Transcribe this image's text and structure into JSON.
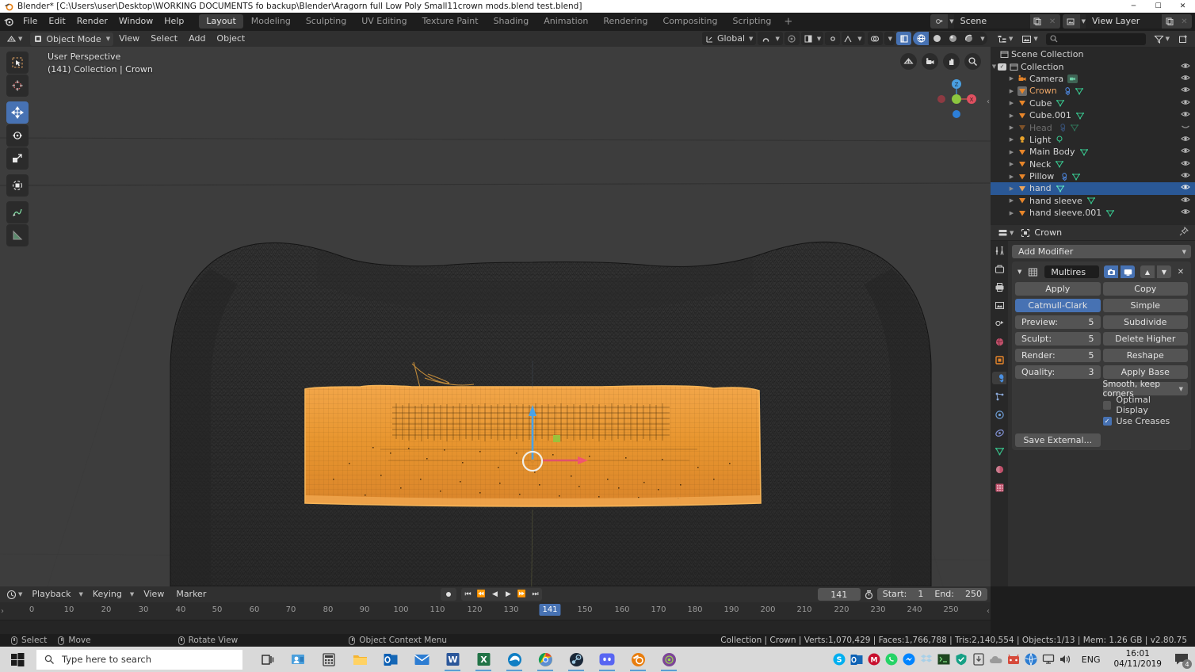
{
  "window": {
    "title": "Blender* [C:\\Users\\user\\Desktop\\WORKING DOCUMENTS fo backup\\Blender\\Aragorn full Low Poly Small11crown mods.blend test.blend]",
    "minimize": "─",
    "maximize": "☐",
    "close": "✕"
  },
  "topbar": {
    "menus": [
      "File",
      "Edit",
      "Render",
      "Window",
      "Help"
    ],
    "tabs": [
      "Layout",
      "Modeling",
      "Sculpting",
      "UV Editing",
      "Texture Paint",
      "Shading",
      "Animation",
      "Rendering",
      "Compositing",
      "Scripting"
    ],
    "tab_active": "Layout",
    "add_tab": "+",
    "scene_name": "Scene",
    "viewlayer_name": "View Layer"
  },
  "viewport_header": {
    "mode": "Object Mode",
    "menus": [
      "View",
      "Select",
      "Add",
      "Object"
    ],
    "transform_orientation": "Global",
    "snap_icon": "magnet-icon",
    "proportional_icon": "proportional-edit-icon"
  },
  "viewport": {
    "perspective_label": "User Perspective",
    "object_label": "(141) Collection | Crown",
    "axis_x": "X",
    "axis_z": "Z",
    "tools": [
      {
        "name": "tweak-tool",
        "glyph": "⬚"
      },
      {
        "name": "cursor-tool",
        "glyph": "⊕"
      },
      {
        "name": "move-tool",
        "glyph": "✛"
      },
      {
        "name": "rotate-tool",
        "glyph": "↺"
      },
      {
        "name": "scale-tool",
        "glyph": "◱"
      },
      {
        "name": "transform-tool",
        "glyph": "▣"
      },
      {
        "name": "annotate-tool",
        "glyph": "✎"
      },
      {
        "name": "measure-tool",
        "glyph": "◥"
      }
    ],
    "active_tool": "move-tool"
  },
  "outliner": {
    "search_placeholder": "",
    "root": "Scene Collection",
    "items": [
      {
        "label": "Collection",
        "indent": 1,
        "type": "collection",
        "selected": false,
        "dim": false,
        "checkbox": true
      },
      {
        "label": "Camera",
        "indent": 2,
        "type": "camera",
        "selected": false,
        "dim": false,
        "extra": [
          "camera-data-icon"
        ]
      },
      {
        "label": "Crown",
        "indent": 2,
        "type": "mesh",
        "selected": false,
        "dim": false,
        "highlight": true,
        "extra": [
          "modifier-icon",
          "mesh-data-icon"
        ]
      },
      {
        "label": "Cube",
        "indent": 2,
        "type": "mesh",
        "selected": false,
        "dim": false,
        "extra": [
          "mesh-data-icon"
        ]
      },
      {
        "label": "Cube.001",
        "indent": 2,
        "type": "mesh",
        "selected": false,
        "dim": false,
        "extra": [
          "mesh-data-icon"
        ]
      },
      {
        "label": "Head",
        "indent": 2,
        "type": "mesh",
        "selected": false,
        "dim": true,
        "extra": [
          "modifier-icon",
          "mesh-data-icon"
        ]
      },
      {
        "label": "Light",
        "indent": 2,
        "type": "light",
        "selected": false,
        "dim": false,
        "extra": [
          "light-data-icon"
        ]
      },
      {
        "label": "Main Body",
        "indent": 2,
        "type": "mesh",
        "selected": false,
        "dim": false,
        "extra": [
          "mesh-data-icon"
        ]
      },
      {
        "label": "Neck",
        "indent": 2,
        "type": "mesh",
        "selected": false,
        "dim": false,
        "extra": [
          "mesh-data-icon"
        ]
      },
      {
        "label": "Pillow",
        "indent": 2,
        "type": "mesh",
        "selected": false,
        "dim": false,
        "extra": [
          "modifier-icon",
          "mesh-data-icon"
        ]
      },
      {
        "label": "hand",
        "indent": 2,
        "type": "mesh",
        "selected": true,
        "dim": false,
        "extra": [
          "mesh-data-icon"
        ]
      },
      {
        "label": "hand sleeve",
        "indent": 2,
        "type": "mesh",
        "selected": false,
        "dim": false,
        "extra": [
          "mesh-data-icon"
        ]
      },
      {
        "label": "hand sleeve.001",
        "indent": 2,
        "type": "mesh",
        "selected": false,
        "dim": false,
        "extra": [
          "mesh-data-icon"
        ]
      }
    ]
  },
  "properties": {
    "breadcrumb_object": "Crown",
    "add_modifier": "Add Modifier",
    "modifier": {
      "name": "Multires",
      "apply": "Apply",
      "copy": "Copy",
      "subdiv_type_catmull": "Catmull-Clark",
      "subdiv_type_simple": "Simple",
      "preview_label": "Preview:",
      "preview_value": "5",
      "sculpt_label": "Sculpt:",
      "sculpt_value": "5",
      "render_label": "Render:",
      "render_value": "5",
      "quality_label": "Quality:",
      "quality_value": "3",
      "subdivide": "Subdivide",
      "delete_higher": "Delete Higher",
      "reshape": "Reshape",
      "apply_base": "Apply Base",
      "uv_smooth": "Smooth, keep corners",
      "optimal_display": "Optimal Display",
      "optimal_display_checked": false,
      "use_creases": "Use Creases",
      "use_creases_checked": true,
      "save_external": "Save External..."
    },
    "tabs": [
      {
        "name": "tool-tab",
        "glyph": "⚒"
      },
      {
        "name": "render-tab",
        "glyph": "▣"
      },
      {
        "name": "output-tab",
        "glyph": "⎙"
      },
      {
        "name": "viewlayer-tab",
        "glyph": "⛰"
      },
      {
        "name": "scene-tab",
        "glyph": "◔"
      },
      {
        "name": "world-tab",
        "glyph": "●"
      },
      {
        "name": "object-tab",
        "glyph": "□"
      },
      {
        "name": "modifier-tab",
        "glyph": "🔧"
      },
      {
        "name": "particles-tab",
        "glyph": "⁂"
      },
      {
        "name": "physics-tab",
        "glyph": "◎"
      },
      {
        "name": "constraints-tab",
        "glyph": "⛓"
      },
      {
        "name": "data-tab",
        "glyph": "▽"
      },
      {
        "name": "material-tab",
        "glyph": "◕"
      },
      {
        "name": "texture-tab",
        "glyph": "▒"
      }
    ],
    "active_tab": "modifier-tab"
  },
  "timeline": {
    "menus": [
      "Playback",
      "Keying",
      "View",
      "Marker"
    ],
    "current_frame": "141",
    "start_label": "Start:",
    "start_value": "1",
    "end_label": "End:",
    "end_value": "250",
    "ticks": [
      "0",
      "10",
      "20",
      "30",
      "40",
      "50",
      "60",
      "70",
      "80",
      "90",
      "100",
      "110",
      "120",
      "130",
      "141",
      "150",
      "160",
      "170",
      "180",
      "190",
      "200",
      "210",
      "220",
      "230",
      "240",
      "250"
    ],
    "playhead_frame": "141"
  },
  "statusbar": {
    "hints": [
      {
        "icon": "mouse-left-icon",
        "label": "Select"
      },
      {
        "icon": "mouse-move-icon",
        "label": "Move"
      },
      {
        "icon": "mouse-middle-icon",
        "label": "Rotate View"
      },
      {
        "icon": "mouse-right-icon",
        "label": "Object Context Menu"
      }
    ],
    "stats": "Collection | Crown | Verts:1,070,429 | Faces:1,766,788 | Tris:2,140,554 | Objects:1/13 | Mem: 1.26 GB | v2.80.75"
  },
  "taskbar": {
    "search_placeholder": "Type here to search",
    "time": "16:01",
    "date": "04/11/2019",
    "language": "ENG",
    "notification_count": "4",
    "pinned": [
      {
        "name": "task-view-icon",
        "color": "#1b1b1b",
        "glyph": "▤"
      },
      {
        "name": "people-icon",
        "color": "#4a9fdc",
        "glyph": "▣"
      },
      {
        "name": "calculator-icon",
        "color": "#3c3c3c",
        "glyph": "⌸"
      },
      {
        "name": "file-explorer-icon",
        "color": "#f5b431",
        "glyph": "🗀"
      },
      {
        "name": "outlook-icon",
        "color": "#0a5fb4",
        "glyph": "O"
      },
      {
        "name": "mail-icon",
        "color": "#2d7dd2",
        "glyph": "✉"
      },
      {
        "name": "word-icon",
        "color": "#2b579a",
        "glyph": "W"
      },
      {
        "name": "excel-icon",
        "color": "#217346",
        "glyph": "X"
      },
      {
        "name": "edge-icon",
        "color": "#0f7ec4",
        "glyph": "e"
      },
      {
        "name": "chrome-icon",
        "color": "#d64b3c",
        "glyph": "◉"
      },
      {
        "name": "steam-icon",
        "color": "#1b2838",
        "glyph": "●"
      },
      {
        "name": "discord-icon",
        "color": "#5865f2",
        "glyph": "◑"
      },
      {
        "name": "blender-icon",
        "color": "#e87d0d",
        "glyph": "◎"
      },
      {
        "name": "tor-icon",
        "color": "#7d4698",
        "glyph": "●"
      }
    ],
    "tray": [
      {
        "name": "skype-icon",
        "color": "#00aff0",
        "glyph": "S"
      },
      {
        "name": "outlook-tray-icon",
        "color": "#0a5fb4",
        "glyph": "▣"
      },
      {
        "name": "mcafee-icon",
        "color": "#c8102e",
        "glyph": "M"
      },
      {
        "name": "whatsapp-icon",
        "color": "#25d366",
        "glyph": "●"
      },
      {
        "name": "messenger-icon",
        "color": "#0084ff",
        "glyph": "●"
      },
      {
        "name": "dropbox-icon",
        "color": "#d7e8f5",
        "glyph": "◆"
      },
      {
        "name": "terminal-icon",
        "color": "#1e4620",
        "glyph": "■"
      },
      {
        "name": "security-icon",
        "color": "#16a085",
        "glyph": "⬢"
      },
      {
        "name": "removable-drive-icon",
        "color": "#4a4a4a",
        "glyph": "⬚"
      },
      {
        "name": "onedrive-icon",
        "color": "#8a8a8a",
        "glyph": "☁"
      },
      {
        "name": "updates-icon",
        "color": "#d64b3c",
        "glyph": "◑"
      },
      {
        "name": "globe-icon",
        "color": "#2d7dd2",
        "glyph": "◕"
      },
      {
        "name": "network-icon",
        "color": "#3c3c3c",
        "glyph": "⌸"
      },
      {
        "name": "volume-icon",
        "color": "#3c3c3c",
        "glyph": "🔊"
      }
    ]
  },
  "colors": {
    "blender_bg": "#1d1d1d",
    "panel": "#303030",
    "outliner_bg": "#282828",
    "accent_blue": "#4772b3",
    "select_orange": "#ed9e3f",
    "viewport_bg": "#3d3d3d",
    "taskbar": "#d9d9d9"
  }
}
